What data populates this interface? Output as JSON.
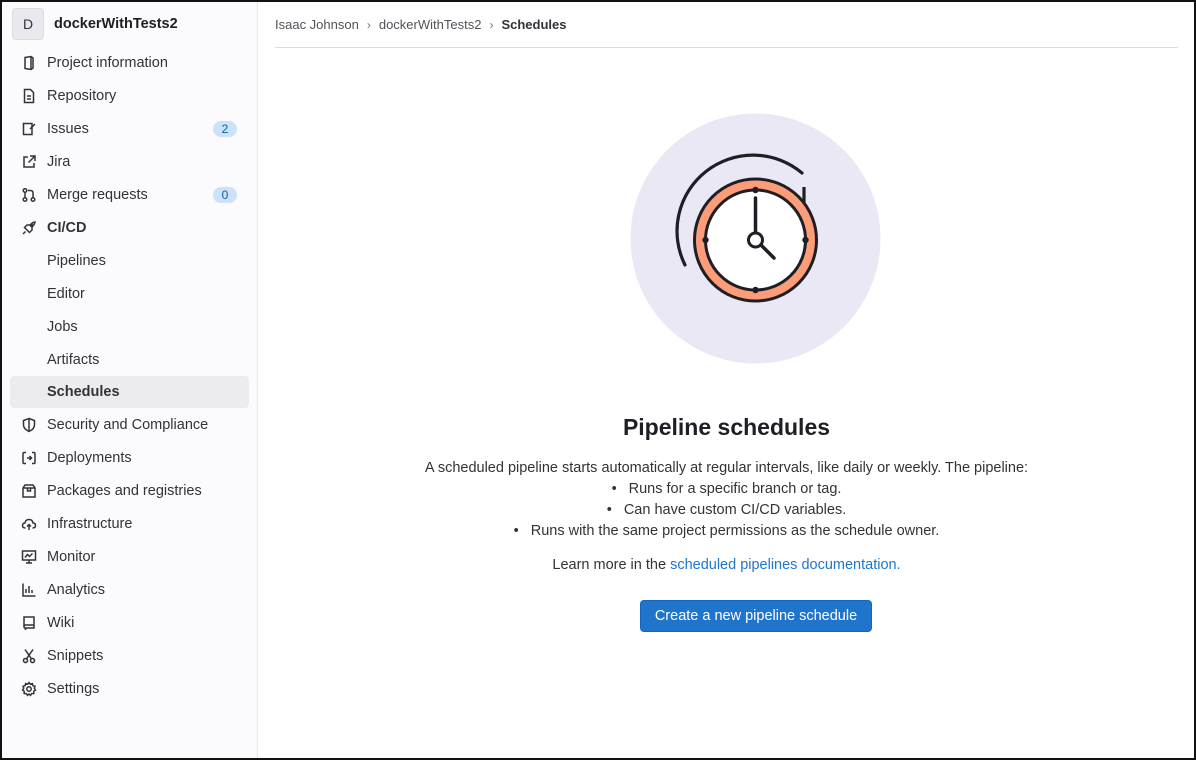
{
  "project": {
    "avatar_letter": "D",
    "name": "dockerWithTests2"
  },
  "sidebar": {
    "items": [
      {
        "label": "Project information",
        "icon": "project-info-icon"
      },
      {
        "label": "Repository",
        "icon": "document-icon"
      },
      {
        "label": "Issues",
        "icon": "issues-icon",
        "badge": "2"
      },
      {
        "label": "Jira",
        "icon": "external-link-icon"
      },
      {
        "label": "Merge requests",
        "icon": "merge-request-icon",
        "badge": "0"
      },
      {
        "label": "CI/CD",
        "icon": "rocket-icon"
      },
      {
        "label": "Pipelines"
      },
      {
        "label": "Editor"
      },
      {
        "label": "Jobs"
      },
      {
        "label": "Artifacts"
      },
      {
        "label": "Schedules",
        "active": true
      },
      {
        "label": "Security and Compliance",
        "icon": "shield-icon"
      },
      {
        "label": "Deployments",
        "icon": "deployments-icon"
      },
      {
        "label": "Packages and registries",
        "icon": "package-icon"
      },
      {
        "label": "Infrastructure",
        "icon": "cloud-icon"
      },
      {
        "label": "Monitor",
        "icon": "monitor-icon"
      },
      {
        "label": "Analytics",
        "icon": "chart-icon"
      },
      {
        "label": "Wiki",
        "icon": "book-icon"
      },
      {
        "label": "Snippets",
        "icon": "scissors-icon"
      },
      {
        "label": "Settings",
        "icon": "gear-icon"
      }
    ]
  },
  "breadcrumbs": {
    "user": "Isaac Johnson",
    "project": "dockerWithTests2",
    "current": "Schedules",
    "separator": "›"
  },
  "empty_state": {
    "title": "Pipeline schedules",
    "intro": "A scheduled pipeline starts automatically at regular intervals, like daily or weekly. The pipeline:",
    "bullets": [
      "Runs for a specific branch or tag.",
      "Can have custom CI/CD variables.",
      "Runs with the same project permissions as the schedule owner."
    ],
    "learn_prefix": "Learn more in the ",
    "learn_link": "scheduled pipelines documentation.",
    "button": "Create a new pipeline schedule"
  },
  "colors": {
    "accent": "#1f75cb",
    "illustration_bg": "#e9e8f4",
    "clock_ring": "#fc9c78"
  }
}
